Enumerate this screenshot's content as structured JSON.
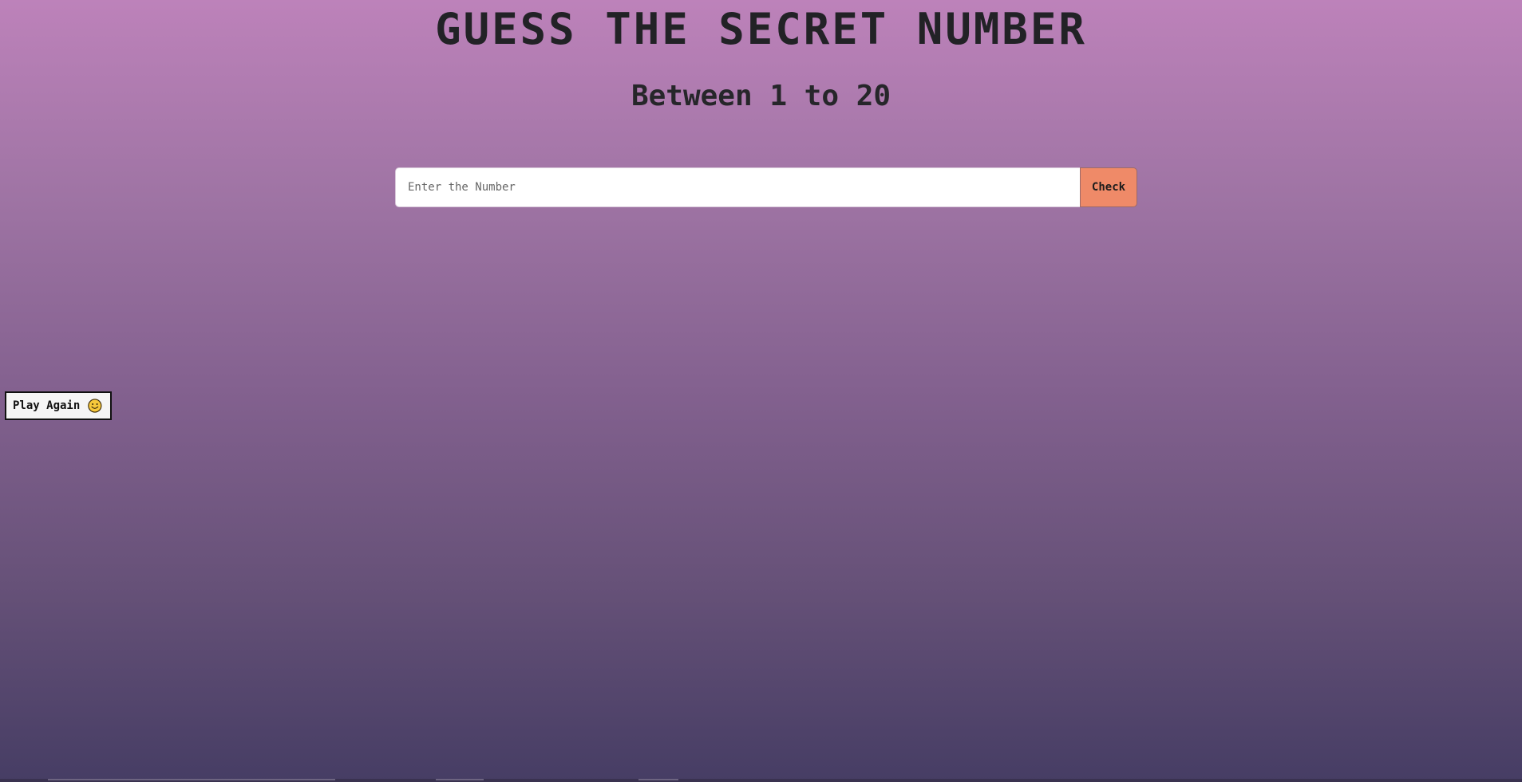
{
  "header": {
    "title": "GUESS THE SECRET NUMBER",
    "subtitle": "Between 1 to 20"
  },
  "guess_form": {
    "input_value": "",
    "input_placeholder": "Enter the Number",
    "check_label": "Check"
  },
  "play_again": {
    "label": "Play Again",
    "icon": "smiley-face-icon"
  },
  "colors": {
    "gradient_top": "#bd82ba",
    "gradient_bottom": "#463d64",
    "check_button": "#ef8a68",
    "title_text": "#222226"
  }
}
